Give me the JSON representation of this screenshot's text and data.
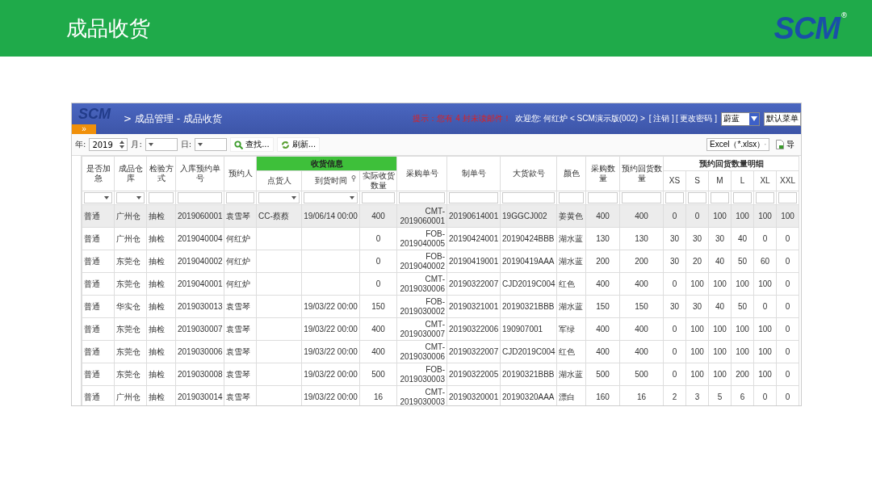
{
  "slide": {
    "title": "成品收货",
    "logo": "SCM",
    "logo_mark": "®"
  },
  "app": {
    "logo": "SCM",
    "breadcrumb": "> 成品管理 - 成品收货",
    "notice": "提示：您有 4 封未读邮件！",
    "welcome": "欢迎您: 何红炉 < SCM演示版(002) >",
    "links": [
      "[ 注销 ]",
      "[ 更改密码 ]"
    ],
    "theme": "蔚蓝",
    "menu_button": "默认菜单",
    "expand": "»"
  },
  "toolbar": {
    "year_label": "年:",
    "year": "2019",
    "month_label": "月:",
    "day_label": "日:",
    "find": "查找...",
    "refresh": "刷新...",
    "export_format": "Excel（*.xlsx）",
    "export": "导"
  },
  "columns": [
    {
      "label": "是否加急"
    },
    {
      "label": "成品仓库"
    },
    {
      "label": "检验方式"
    },
    {
      "label": "入库预约单号"
    },
    {
      "label": "预约人"
    },
    {
      "group": "收货信息",
      "highlight": true,
      "children": [
        {
          "label": "点货人"
        },
        {
          "label": "到货时间",
          "filter_icon": true
        },
        {
          "label": "实际收货数量"
        }
      ]
    },
    {
      "label": "采购单号"
    },
    {
      "label": "制单号"
    },
    {
      "label": "大货款号"
    },
    {
      "label": "颜色"
    },
    {
      "label": "采购数量"
    },
    {
      "label": "预约回货数量"
    },
    {
      "group": "预约回货数量明细",
      "highlight": false,
      "children": [
        {
          "label": "XS"
        },
        {
          "label": "S"
        },
        {
          "label": "M"
        },
        {
          "label": "L"
        },
        {
          "label": "XL"
        },
        {
          "label": "XXL"
        }
      ]
    }
  ],
  "filters": [
    {
      "kind": "select"
    },
    {
      "kind": "select"
    },
    {
      "kind": "text"
    },
    {
      "kind": "text"
    },
    {
      "kind": "text"
    },
    {
      "kind": "select"
    },
    {
      "kind": "select"
    },
    {
      "kind": "text"
    },
    {
      "kind": "text"
    },
    {
      "kind": "text"
    },
    {
      "kind": "text"
    },
    {
      "kind": "text"
    },
    {
      "kind": "text"
    },
    {
      "kind": "text"
    },
    {
      "kind": "text"
    },
    {
      "kind": "text"
    },
    {
      "kind": "text"
    },
    {
      "kind": "text"
    },
    {
      "kind": "text"
    },
    {
      "kind": "text"
    }
  ],
  "rows": [
    {
      "selected": true,
      "cells": [
        "普通",
        "广州仓",
        "抽检",
        "2019060001",
        "袁雪琴",
        "CC-蔡蔡",
        "19/06/14 00:00",
        "400",
        "CMT-2019060001",
        "20190614001",
        "19GGCJ002",
        "姜黄色",
        "400",
        "400",
        "0",
        "0",
        "100",
        "100",
        "100",
        "100"
      ]
    },
    {
      "selected": false,
      "cells": [
        "普通",
        "广州仓",
        "抽检",
        "2019040004",
        "何红炉",
        "",
        "",
        "0",
        "FOB-2019040005",
        "20190424001",
        "20190424BBB",
        "湖水蓝",
        "130",
        "130",
        "30",
        "30",
        "30",
        "40",
        "0",
        "0"
      ]
    },
    {
      "selected": false,
      "cells": [
        "普通",
        "东莞仓",
        "抽检",
        "2019040002",
        "何红炉",
        "",
        "",
        "0",
        "FOB-2019040002",
        "20190419001",
        "20190419AAA",
        "湖水蓝",
        "200",
        "200",
        "30",
        "20",
        "40",
        "50",
        "60",
        "0"
      ]
    },
    {
      "selected": false,
      "cells": [
        "普通",
        "东莞仓",
        "抽检",
        "2019040001",
        "何红炉",
        "",
        "",
        "0",
        "CMT-2019030006",
        "20190322007",
        "CJD2019C004",
        "红色",
        "400",
        "400",
        "0",
        "100",
        "100",
        "100",
        "100",
        "0"
      ]
    },
    {
      "selected": false,
      "cells": [
        "普通",
        "华实仓",
        "抽检",
        "2019030013",
        "袁雪琴",
        "",
        "19/03/22 00:00",
        "150",
        "FOB-2019030002",
        "20190321001",
        "20190321BBB",
        "湖水蓝",
        "150",
        "150",
        "30",
        "30",
        "40",
        "50",
        "0",
        "0"
      ]
    },
    {
      "selected": false,
      "cells": [
        "普通",
        "东莞仓",
        "抽检",
        "2019030007",
        "袁雪琴",
        "",
        "19/03/22 00:00",
        "400",
        "CMT-2019030007",
        "20190322006",
        "190907001",
        "军绿",
        "400",
        "400",
        "0",
        "100",
        "100",
        "100",
        "100",
        "0"
      ]
    },
    {
      "selected": false,
      "cells": [
        "普通",
        "东莞仓",
        "抽检",
        "2019030006",
        "袁雪琴",
        "",
        "19/03/22 00:00",
        "400",
        "CMT-2019030006",
        "20190322007",
        "CJD2019C004",
        "红色",
        "400",
        "400",
        "0",
        "100",
        "100",
        "100",
        "100",
        "0"
      ]
    },
    {
      "selected": false,
      "cells": [
        "普通",
        "东莞仓",
        "抽检",
        "2019030008",
        "袁雪琴",
        "",
        "19/03/22 00:00",
        "500",
        "FOB-2019030003",
        "20190322005",
        "20190321BBB",
        "湖水蓝",
        "500",
        "500",
        "0",
        "100",
        "100",
        "200",
        "100",
        "0"
      ]
    },
    {
      "selected": false,
      "cells": [
        "普通",
        "广州仓",
        "抽检",
        "2019030014",
        "袁雪琴",
        "",
        "19/03/22 00:00",
        "16",
        "CMT-2019030003",
        "20190320001",
        "20190320AAA",
        "漂白",
        "160",
        "16",
        "2",
        "3",
        "5",
        "6",
        "0",
        "0"
      ]
    }
  ]
}
